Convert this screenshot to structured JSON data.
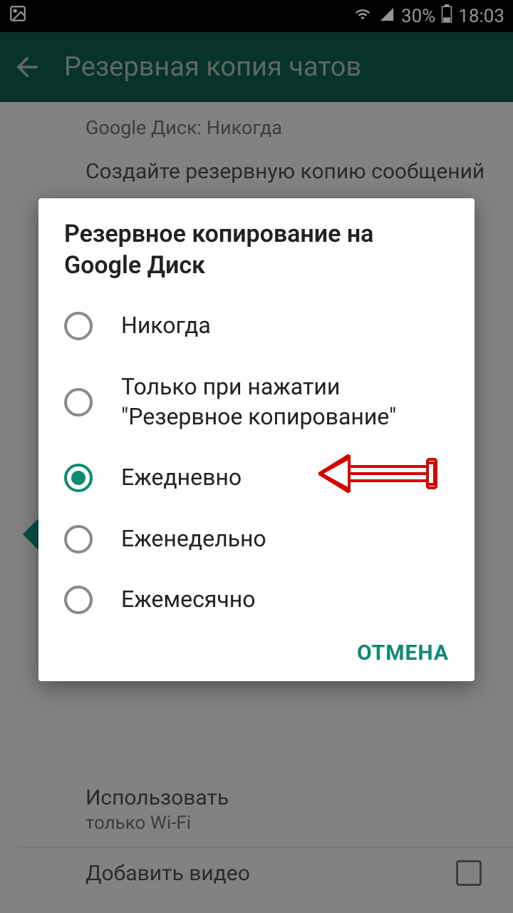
{
  "status": {
    "battery_percent": "30%",
    "time": "18:03"
  },
  "header": {
    "title": "Резервная копия чатов"
  },
  "background": {
    "line1": "Google Диск: Никогда",
    "line2": "Создайте резервную копию сообщений",
    "use_title": "Использовать",
    "use_subtitle": "только Wi-Fi",
    "add_video": "Добавить видео"
  },
  "dialog": {
    "title": "Резервное копирование на Google Диск",
    "options": [
      {
        "label": "Никогда",
        "selected": false
      },
      {
        "label": "Только при нажатии \"Резервное копирование\"",
        "selected": false
      },
      {
        "label": "Ежедневно",
        "selected": true
      },
      {
        "label": "Еженедельно",
        "selected": false
      },
      {
        "label": "Ежемесячно",
        "selected": false
      }
    ],
    "cancel": "ОТМЕНА"
  }
}
